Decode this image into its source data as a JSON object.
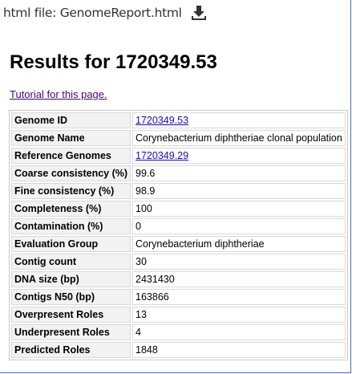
{
  "header": {
    "file_label": "html file: GenomeReport.html",
    "download_icon": "download-icon"
  },
  "title": "Results for 1720349.53",
  "tutorial_link": "Tutorial for this page.",
  "rows": [
    {
      "label": "Genome ID",
      "value": "1720349.53",
      "is_link": true
    },
    {
      "label": "Genome Name",
      "value": "Corynebacterium diphtheriae clonal population",
      "is_link": false
    },
    {
      "label": "Reference Genomes",
      "value": "1720349.29",
      "is_link": true
    },
    {
      "label": "Coarse consistency (%)",
      "value": "99.6",
      "is_link": false
    },
    {
      "label": "Fine consistency (%)",
      "value": "98.9",
      "is_link": false
    },
    {
      "label": "Completeness (%)",
      "value": "100",
      "is_link": false
    },
    {
      "label": "Contamination (%)",
      "value": "0",
      "is_link": false
    },
    {
      "label": "Evaluation Group",
      "value": "Corynebacterium diphtheriae",
      "is_link": false
    },
    {
      "label": "Contig count",
      "value": "30",
      "is_link": false
    },
    {
      "label": "DNA size (bp)",
      "value": "2431430",
      "is_link": false
    },
    {
      "label": "Contigs N50 (bp)",
      "value": "163866",
      "is_link": false
    },
    {
      "label": "Overpresent Roles",
      "value": "13",
      "is_link": false
    },
    {
      "label": "Underpresent Roles",
      "value": "4",
      "is_link": false
    },
    {
      "label": "Predicted Roles",
      "value": "1848",
      "is_link": false
    }
  ],
  "colors": {
    "link": "#1a0dab",
    "visited_link": "#4b0082",
    "key_cell_bg": "#f2f2f2",
    "frame_border": "#4a6fa5"
  }
}
